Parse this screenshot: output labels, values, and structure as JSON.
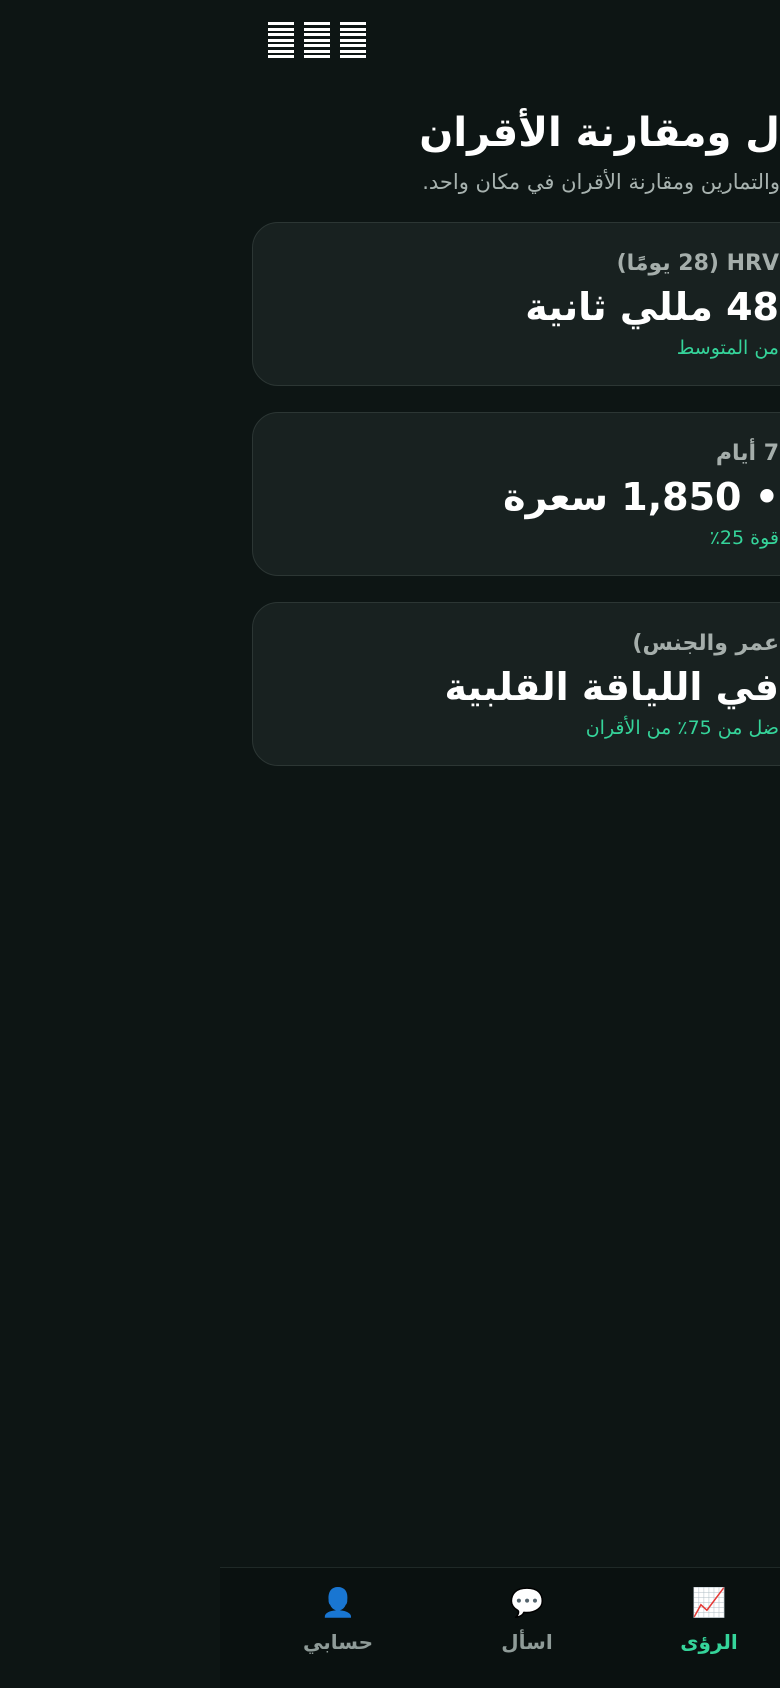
{
  "header": {
    "title": "ل ومقارنة الأقران",
    "subtitle": "والتمارين ومقارنة الأقران في مكان واحد."
  },
  "cards": [
    {
      "label": "HRV (28 يومًا)",
      "value": "48 مللي ثانية",
      "note": "من المتوسط"
    },
    {
      "label": "7 أيام",
      "value": "• 1,850 سعرة",
      "note": "قوة 25٪"
    },
    {
      "label": "عمر والجنس)",
      "value": "في اللياقة القلبية",
      "note": "ضل من 75٪ من الأقران"
    }
  ],
  "tabbar": {
    "tabs": [
      {
        "label": "حسابي",
        "icon": "user-icon",
        "glyph": "👤",
        "active": false
      },
      {
        "label": "اسأل",
        "icon": "speech-bubble-icon",
        "glyph": "💬",
        "active": false
      },
      {
        "label": "الرؤى",
        "icon": "chart-trend-icon",
        "glyph": "📈",
        "active": true
      }
    ]
  },
  "colors": {
    "background": "#0d1514",
    "card": "#182120",
    "accent": "#35d49a",
    "muted": "#a5aeab"
  }
}
